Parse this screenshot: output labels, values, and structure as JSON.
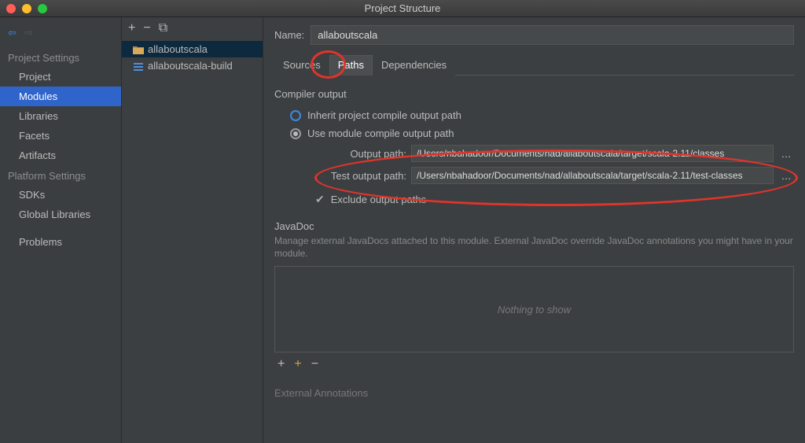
{
  "window": {
    "title": "Project Structure"
  },
  "sidebar": {
    "heading_project": "Project Settings",
    "heading_platform": "Platform Settings",
    "items_project": [
      "Project",
      "Modules",
      "Libraries",
      "Facets",
      "Artifacts"
    ],
    "items_platform": [
      "SDKs",
      "Global Libraries"
    ],
    "item_problems": "Problems"
  },
  "tree": {
    "items": [
      "allaboutscala",
      "allaboutscala-build"
    ]
  },
  "content": {
    "name_label": "Name:",
    "name_value": "allaboutscala",
    "tabs": [
      "Sources",
      "Paths",
      "Dependencies"
    ],
    "compiler_output_label": "Compiler output",
    "inherit_label": "Inherit project compile output path",
    "use_module_label": "Use module compile output path",
    "output_path_label": "Output path:",
    "output_path_value": "/Users/nbahadoor/Documents/nad/allaboutscala/target/scala-2.11/classes",
    "test_output_path_label": "Test output path:",
    "test_output_path_value": "/Users/nbahadoor/Documents/nad/allaboutscala/target/scala-2.11/test-classes",
    "exclude_label": "Exclude output paths",
    "javadoc_label": "JavaDoc",
    "javadoc_desc": "Manage external JavaDocs attached to this module. External JavaDoc override JavaDoc annotations you might have in your module.",
    "nothing_to_show": "Nothing to show",
    "external_annotations_label": "External Annotations"
  }
}
